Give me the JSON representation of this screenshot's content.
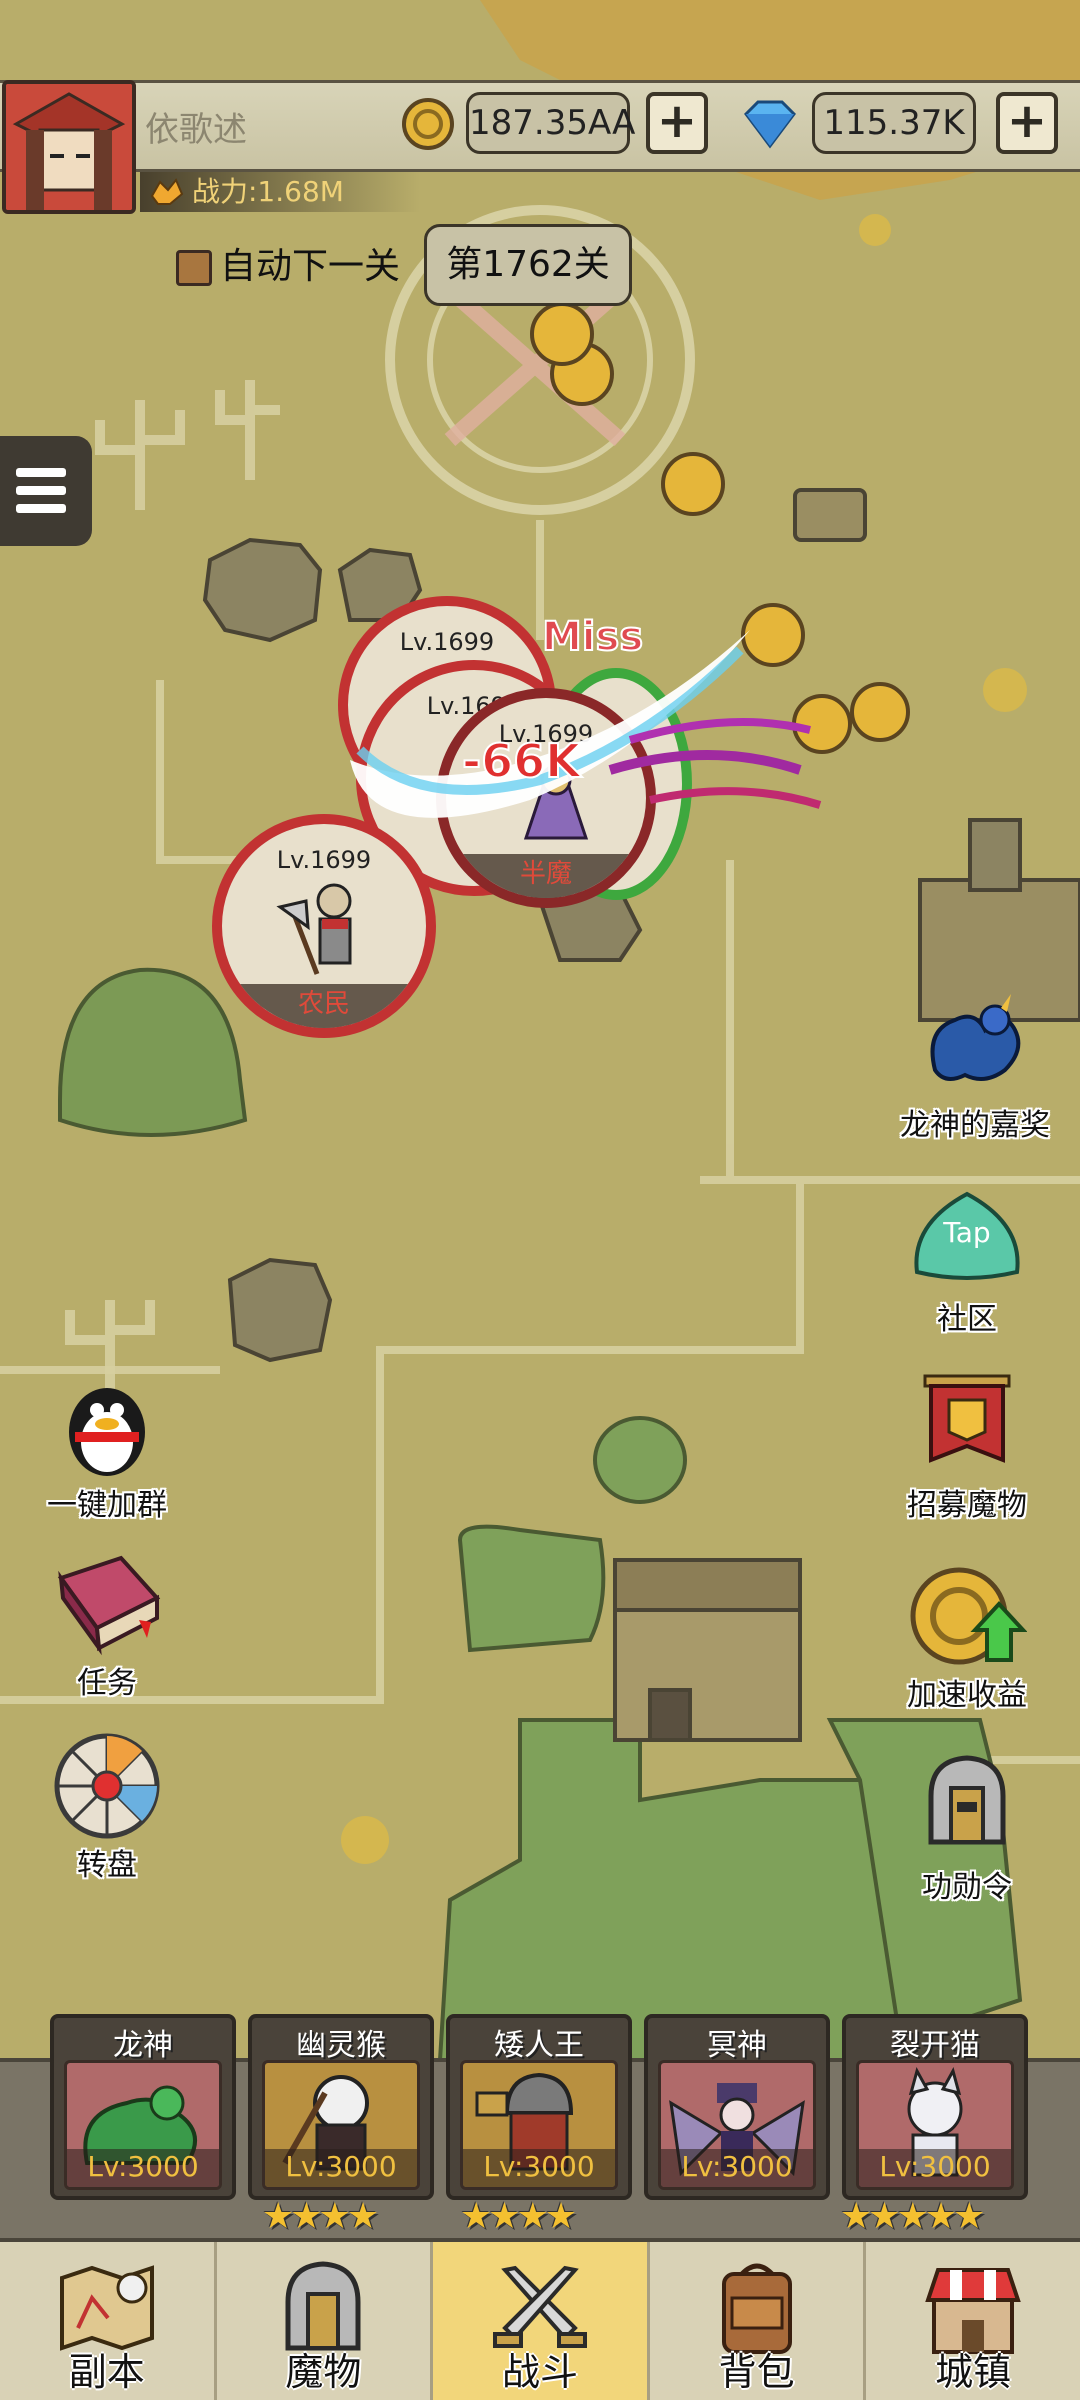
{
  "player": {
    "name": "依歌述",
    "power": "战力:1.68M"
  },
  "currency": {
    "gold": "187.35AA",
    "gems": "115.37K",
    "plus": "+"
  },
  "stage": {
    "auto_next_label": "自动下一关",
    "current_stage": "第1762关"
  },
  "battle": {
    "enemies": [
      {
        "level": "Lv.1699",
        "name": ""
      },
      {
        "level": "Lv.1699",
        "name": ""
      },
      {
        "level": "Lv.1699",
        "name": "半魔"
      },
      {
        "level": "Lv.1699",
        "name": "农民"
      }
    ],
    "miss_text": "Miss",
    "damage_text": "-66K"
  },
  "side_buttons": {
    "left": [
      {
        "label": "一键加群",
        "icon": "qq-penguin-icon"
      },
      {
        "label": "任务",
        "icon": "quest-book-icon"
      },
      {
        "label": "转盘",
        "icon": "wheel-icon"
      }
    ],
    "right": [
      {
        "label": "龙神的嘉奖",
        "icon": "dragon-icon"
      },
      {
        "label": "社区",
        "icon": "taptap-icon",
        "badge": "Tap"
      },
      {
        "label": "招募魔物",
        "icon": "recruit-banner-icon"
      },
      {
        "label": "加速收益",
        "icon": "boost-coin-icon"
      },
      {
        "label": "功勋令",
        "icon": "helmet-icon"
      }
    ]
  },
  "heroes": [
    {
      "name": "龙神",
      "level": "Lv:3000",
      "stars": 0
    },
    {
      "name": "幽灵猴",
      "level": "Lv:3000",
      "stars": 4
    },
    {
      "name": "矮人王",
      "level": "Lv:3000",
      "stars": 4
    },
    {
      "name": "冥神",
      "level": "Lv:3000",
      "stars": 0
    },
    {
      "name": "裂开猫",
      "level": "Lv:3000",
      "stars": 5
    }
  ],
  "nav": {
    "tabs": [
      {
        "label": "副本",
        "icon": "map-icon"
      },
      {
        "label": "魔物",
        "icon": "monster-helmet-icon"
      },
      {
        "label": "战斗",
        "icon": "crossed-swords-icon",
        "active": true
      },
      {
        "label": "背包",
        "icon": "backpack-icon"
      },
      {
        "label": "城镇",
        "icon": "shop-icon"
      }
    ]
  },
  "colors": {
    "map_ground": "#b8ad6a",
    "enemy_ring": "#c23232",
    "active_tab": "#f2d67a",
    "star": "#f4c030",
    "level_text": "#f0c040"
  }
}
